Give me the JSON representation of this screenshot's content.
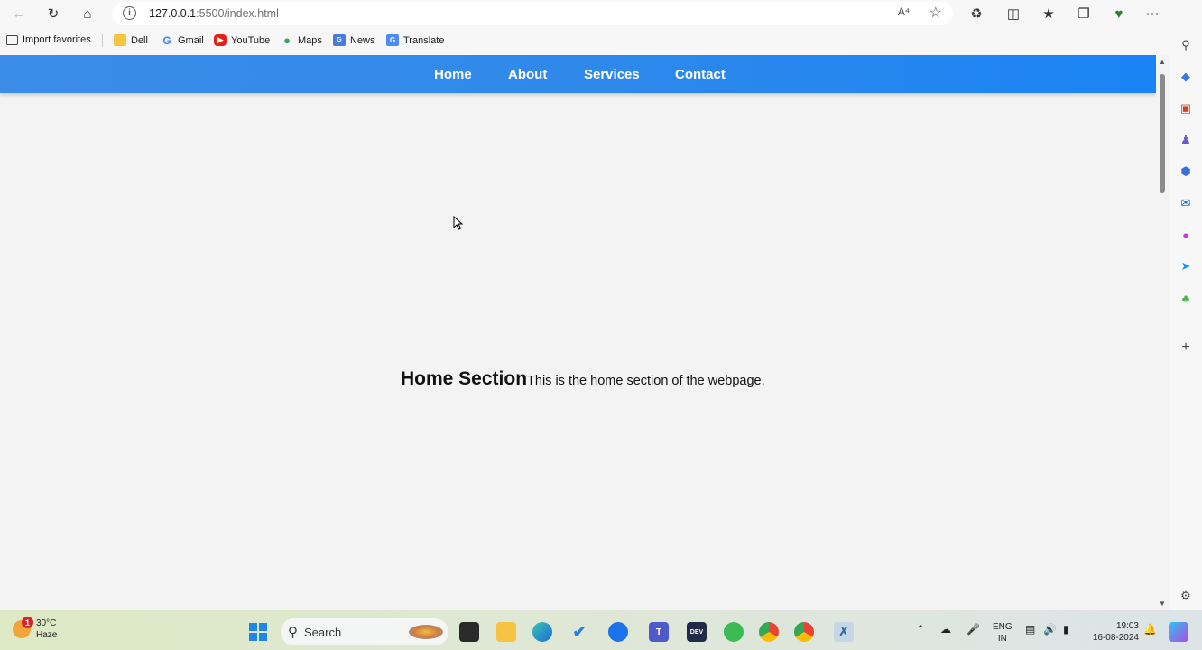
{
  "browser": {
    "url_host": "127.0.0.1",
    "url_rest": ":5500/index.html",
    "read_aloud_label": "A⁴"
  },
  "favorites": [
    {
      "label": "Import favorites",
      "icon": "import-icon"
    },
    {
      "label": "Dell",
      "icon": "folder-icon"
    },
    {
      "label": "Gmail",
      "icon": "google-icon"
    },
    {
      "label": "YouTube",
      "icon": "youtube-icon"
    },
    {
      "label": "Maps",
      "icon": "maps-pin-icon"
    },
    {
      "label": "News",
      "icon": "news-icon"
    },
    {
      "label": "Translate",
      "icon": "translate-icon"
    }
  ],
  "page": {
    "nav": [
      "Home",
      "About",
      "Services",
      "Contact"
    ],
    "section_title": "Home Section",
    "section_text": "This is the home section of the webpage.",
    "nav_color": "#2f89ea"
  },
  "taskbar": {
    "weather_temp": "30°C",
    "weather_desc": "Haze",
    "weather_badge": "1",
    "search_placeholder": "Search",
    "lang_top": "ENG",
    "lang_bottom": "IN",
    "time": "19:03",
    "date": "16-08-2024"
  }
}
